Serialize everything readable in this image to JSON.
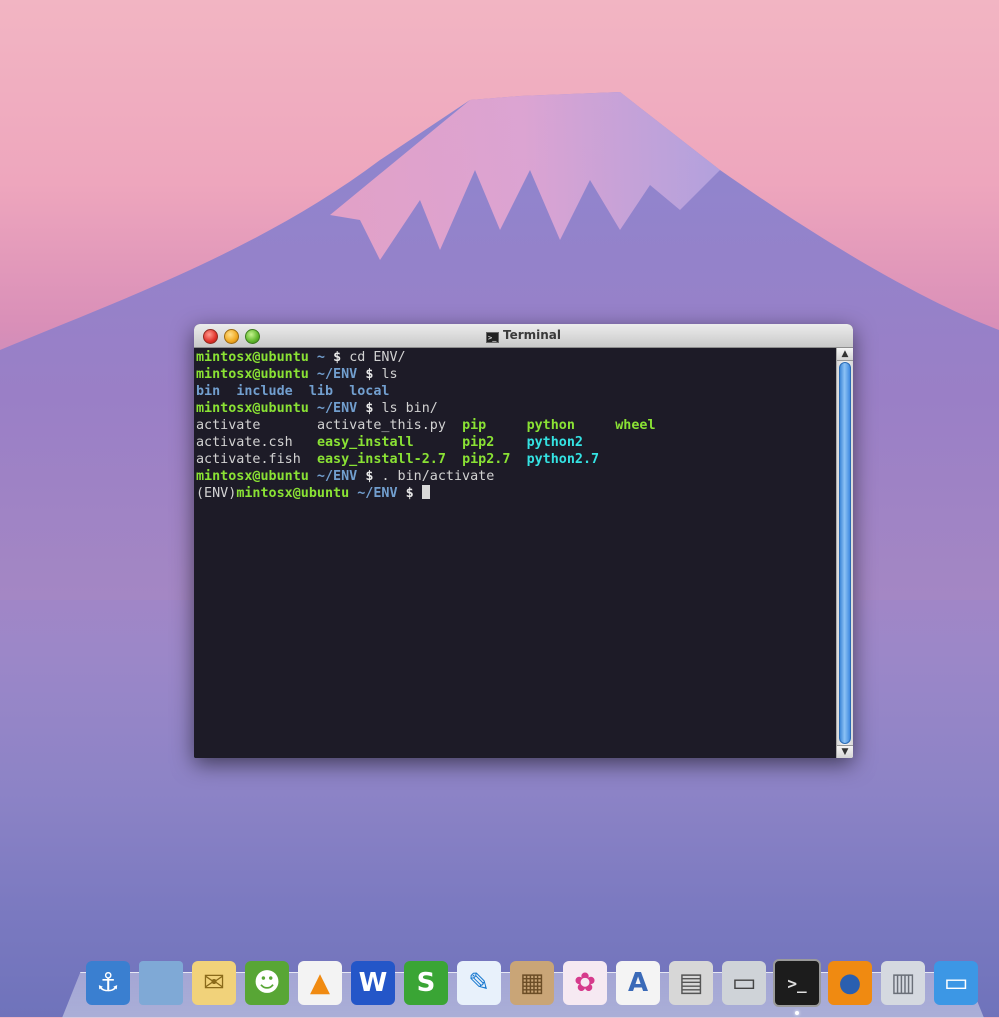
{
  "window": {
    "title": "Terminal",
    "icon": "terminal-icon"
  },
  "terminal": {
    "lines": [
      [
        {
          "t": "mintosx@ubuntu",
          "s": "g"
        },
        {
          "t": " ~ ",
          "s": "b"
        },
        {
          "t": "$ ",
          "s": "w"
        },
        {
          "t": "cd ENV/",
          "s": ""
        }
      ],
      [
        {
          "t": "mintosx@ubuntu",
          "s": "g"
        },
        {
          "t": " ~/ENV ",
          "s": "b"
        },
        {
          "t": "$ ",
          "s": "w"
        },
        {
          "t": "ls",
          "s": ""
        }
      ],
      [
        {
          "t": "bin",
          "s": "b"
        },
        {
          "t": "  ",
          "s": ""
        },
        {
          "t": "include",
          "s": "b"
        },
        {
          "t": "  ",
          "s": ""
        },
        {
          "t": "lib",
          "s": "b"
        },
        {
          "t": "  ",
          "s": ""
        },
        {
          "t": "local",
          "s": "b"
        }
      ],
      [
        {
          "t": "mintosx@ubuntu",
          "s": "g"
        },
        {
          "t": " ~/ENV ",
          "s": "b"
        },
        {
          "t": "$ ",
          "s": "w"
        },
        {
          "t": "ls bin/",
          "s": ""
        }
      ],
      [
        {
          "t": "activate       ",
          "s": ""
        },
        {
          "t": "activate_this.py  ",
          "s": ""
        },
        {
          "t": "pip",
          "s": "g"
        },
        {
          "t": "     ",
          "s": ""
        },
        {
          "t": "python",
          "s": "g"
        },
        {
          "t": "     ",
          "s": ""
        },
        {
          "t": "wheel",
          "s": "g"
        }
      ],
      [
        {
          "t": "activate.csh   ",
          "s": ""
        },
        {
          "t": "easy_install",
          "s": "g"
        },
        {
          "t": "      ",
          "s": ""
        },
        {
          "t": "pip2",
          "s": "g"
        },
        {
          "t": "    ",
          "s": ""
        },
        {
          "t": "python2",
          "s": "c"
        }
      ],
      [
        {
          "t": "activate.fish  ",
          "s": ""
        },
        {
          "t": "easy_install-2.7",
          "s": "g"
        },
        {
          "t": "  ",
          "s": ""
        },
        {
          "t": "pip2.7",
          "s": "g"
        },
        {
          "t": "  ",
          "s": ""
        },
        {
          "t": "python2.7",
          "s": "c"
        }
      ],
      [
        {
          "t": "mintosx@ubuntu",
          "s": "g"
        },
        {
          "t": " ~/ENV ",
          "s": "b"
        },
        {
          "t": "$ ",
          "s": "w"
        },
        {
          "t": ". bin/activate",
          "s": ""
        }
      ],
      [
        {
          "t": "(ENV)",
          "s": ""
        },
        {
          "t": "mintosx@ubuntu",
          "s": "g"
        },
        {
          "t": " ~/ENV ",
          "s": "b"
        },
        {
          "t": "$ ",
          "s": "w"
        }
      ]
    ]
  },
  "colors": {
    "prompt_user": "#8ae234",
    "prompt_path": "#729fcf",
    "executable": "#8ae234",
    "symlink": "#34e2e2",
    "directory": "#729fcf",
    "terminal_bg": "#1d1b27"
  },
  "dock": {
    "items": [
      {
        "name": "anchor-icon",
        "glyph": "⚓",
        "bg": "#3a7fd0",
        "fg": "#ffffff"
      },
      {
        "name": "folder-icon",
        "glyph": "",
        "bg": "#7fa9d6",
        "fg": "#ffffff"
      },
      {
        "name": "mail-icon",
        "glyph": "✉",
        "bg": "#f1d27a",
        "fg": "#8a6a1a"
      },
      {
        "name": "pidgin-icon",
        "glyph": "☻",
        "bg": "#58a635",
        "fg": "#ffffff"
      },
      {
        "name": "vlc-icon",
        "glyph": "▲",
        "bg": "#f3f3f3",
        "fg": "#f08a11"
      },
      {
        "name": "wps-writer-icon",
        "glyph": "W",
        "bg": "#2456c8",
        "fg": "#ffffff"
      },
      {
        "name": "wps-spreadsheet-icon",
        "glyph": "S",
        "bg": "#3aa535",
        "fg": "#ffffff"
      },
      {
        "name": "feather-icon",
        "glyph": "✎",
        "bg": "#e8f1fb",
        "fg": "#1a7ad0"
      },
      {
        "name": "package-icon",
        "glyph": "▦",
        "bg": "#c9a577",
        "fg": "#6b4d26"
      },
      {
        "name": "flower-icon",
        "glyph": "✿",
        "bg": "#f6e9f2",
        "fg": "#d63a8c"
      },
      {
        "name": "document-viewer-icon",
        "glyph": "A",
        "bg": "#f4f4f4",
        "fg": "#3a6ab8"
      },
      {
        "name": "calculator-icon",
        "glyph": "▤",
        "bg": "#d7d7d7",
        "fg": "#555555"
      },
      {
        "name": "scanner-icon",
        "glyph": "▭",
        "bg": "#cfd3d8",
        "fg": "#444444"
      },
      {
        "name": "terminal-icon",
        "glyph": ">_",
        "bg": "#1c1c1c",
        "fg": "#e0e0e0"
      },
      {
        "name": "firefox-icon",
        "glyph": "●",
        "bg": "#f08a11",
        "fg": "#2a5fb0"
      },
      {
        "name": "trash-icon",
        "glyph": "▥",
        "bg": "#d5d9e0",
        "fg": "#6a6f78"
      },
      {
        "name": "desktop-icon",
        "glyph": "▭",
        "bg": "#3c97e5",
        "fg": "#ffffff"
      }
    ],
    "running": [
      "terminal-icon"
    ]
  }
}
